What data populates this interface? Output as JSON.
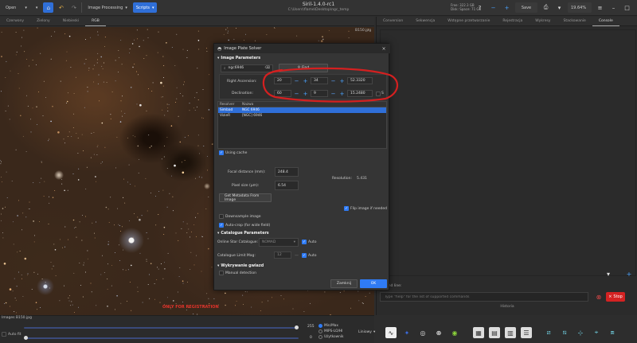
{
  "toolbar": {
    "open_label": "Open",
    "image_processing_label": "Image Processing",
    "scripts_label": "Scripts",
    "title": "Siril-1.4.0-rc1",
    "subtitle": "C:\\Users\\flame\\Desktop\\ngc_temp",
    "mem_free": "Free: 322.3 GB",
    "disk_free": "Disk: Space: 71 GB",
    "save_label": "Save",
    "zoom_label": "19.64%"
  },
  "left_tabs": [
    "Czerwony",
    "Zielony",
    "Niebieski",
    "RGB"
  ],
  "left_active_tab": "RGB",
  "image": {
    "corner_label": "B150.jpg",
    "warning": "ONLY FOR REGISTRATION",
    "file_name": "Images B150.jpg",
    "slider_max": "255",
    "slider_min": "0"
  },
  "bottom": {
    "minmax_label": "Min/Max",
    "mips_label": "MIPS-LO/HI",
    "user_label": "Użytkownik",
    "linear_label": "Liniowy",
    "autofit_label": "Auto fit"
  },
  "right_tabs": [
    "Conversion",
    "Sekwencja",
    "Wstępne przetwarzanie",
    "Rejestracja",
    "Wykresy",
    "Stackowanie",
    "Console"
  ],
  "right_active_tab": "Console",
  "console": {
    "cmd_label": "Cmd line:",
    "placeholder": "Type \"help\" for the list of supported commands",
    "stop_label": "Stop",
    "history_label": "Historia"
  },
  "dialog": {
    "title": "Image Plate Solver",
    "section_image": "Image Parameters",
    "object_value": "ngc6946",
    "find_label": "Find",
    "ra_label": "Right Ascension:",
    "ra_h": "20",
    "ra_m": "34",
    "ra_s": "52.3320",
    "dec_label": "Declination:",
    "dec_d": "60",
    "dec_m": "9",
    "dec_s": "15.2480",
    "dec_sign": "S",
    "results_header": [
      "Resolver",
      "Nazwa"
    ],
    "results": [
      {
        "resolver": "Simbad",
        "name": "NGC 6946",
        "selected": true
      },
      {
        "resolver": "VizieR",
        "name": "[NGC] 6946",
        "selected": false
      }
    ],
    "using_cache": "Using cache",
    "focal_label": "Focal distance (mm):",
    "focal_value": "248.4",
    "pixel_label": "Pixel size (µm):",
    "pixel_value": "6.54",
    "resolution_label": "Resolution:",
    "resolution_value": "5.431",
    "metadata_btn": "Get Metadata From Image",
    "flip_label": "Flip image if needed",
    "downsample_label": "Downsample image",
    "autocrop_label": "Auto-crop (for wide field)",
    "section_catalogue": "Catalogue Parameters",
    "online_cat_label": "Online Star Catalogue:",
    "online_cat_value": "NOMAD",
    "auto_label": "Auto",
    "limit_label": "Catalogue Limit Mag:",
    "limit_value": "12",
    "section_detect": "Wykrywanie gwiazd",
    "manual_label": "Manual detection",
    "close_label": "Zamknij",
    "ok_label": "OK"
  }
}
